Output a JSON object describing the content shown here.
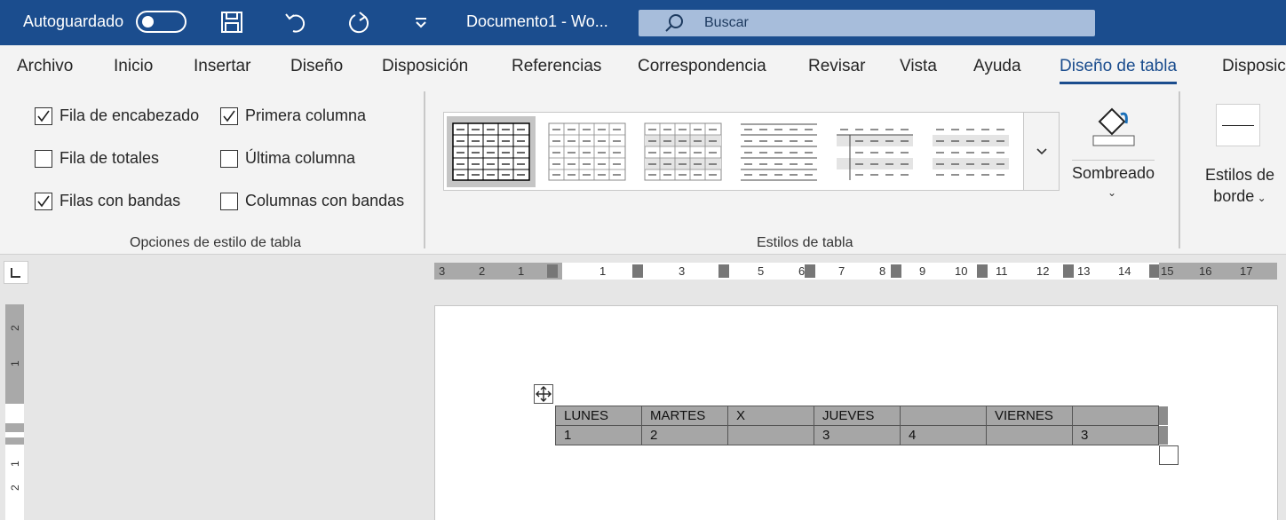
{
  "titlebar": {
    "autosave_label": "Autoguardado",
    "doc_title": "Documento1  -  Wo...",
    "search_placeholder": "Buscar",
    "icons": [
      "save-icon",
      "undo-icon",
      "redo-icon",
      "customize-toolbar-icon",
      "search-icon"
    ],
    "accent_color": "#1b4d8e"
  },
  "tabs": [
    "Archivo",
    "Inicio",
    "Insertar",
    "Diseño",
    "Disposición",
    "Referencias",
    "Correspondencia",
    "Revisar",
    "Vista",
    "Ayuda",
    "Diseño de tabla",
    "Disposic"
  ],
  "active_tab": "Diseño de tabla",
  "style_options": {
    "group_label": "Opciones de estilo de tabla",
    "header_row": {
      "label": "Fila de encabezado",
      "checked": true
    },
    "total_row": {
      "label": "Fila de totales",
      "checked": false
    },
    "banded_rows": {
      "label": "Filas con bandas",
      "checked": true
    },
    "first_column": {
      "label": "Primera columna",
      "checked": true
    },
    "last_column": {
      "label": "Última columna",
      "checked": false
    },
    "banded_columns": {
      "label": "Columnas con bandas",
      "checked": false
    }
  },
  "table_styles": {
    "group_label": "Estilos de tabla",
    "shading_label": "Sombreado",
    "border_styles_label_line1": "Estilos de",
    "border_styles_label_line2": "borde"
  },
  "ruler": {
    "horizontal_labels": [
      "3",
      "2",
      "1",
      "1",
      "3",
      "5",
      "6",
      "7",
      "8",
      "9",
      "10",
      "11",
      "12",
      "13",
      "14",
      "15",
      "16",
      "17"
    ],
    "vertical_labels": [
      "2",
      "1",
      "1",
      "2"
    ]
  },
  "document_table": {
    "rows": [
      [
        "LUNES",
        "MARTES",
        "X",
        "JUEVES",
        "",
        "VIERNES",
        ""
      ],
      [
        "1",
        "2",
        "",
        "3",
        "4",
        "",
        "3"
      ]
    ]
  }
}
